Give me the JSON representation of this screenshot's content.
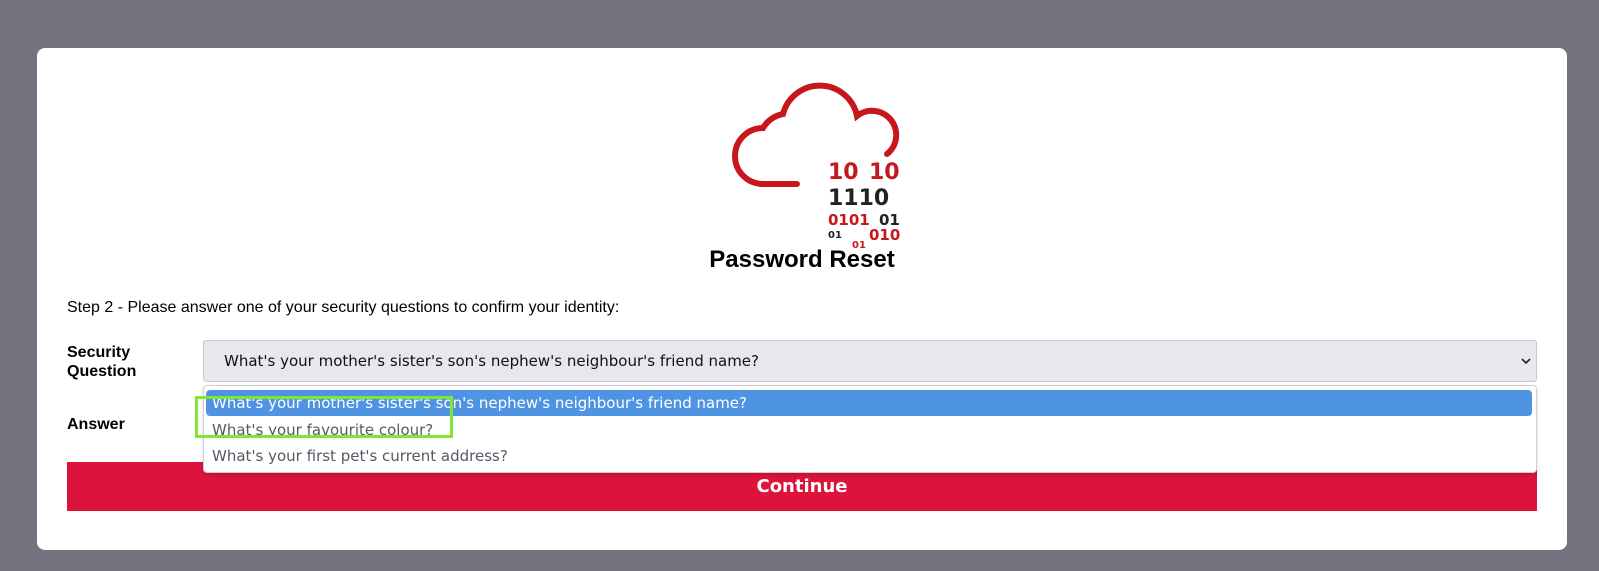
{
  "page": {
    "title": "Password Reset",
    "step_text": "Step 2 - Please answer one of your security questions to confirm your identity:"
  },
  "logo": {
    "digits": [
      "10",
      "10",
      "1110",
      "0101",
      "01",
      "01",
      "01",
      "010"
    ],
    "colors": {
      "red": "#c8161d",
      "dark": "#222222"
    }
  },
  "form": {
    "question_label": "Security Question",
    "answer_label": "Answer",
    "selected_question": "What's your mother's sister's son's nephew's neighbour's friend name?",
    "answer_value": "",
    "continue_label": "Continue"
  },
  "dropdown": {
    "options": [
      "What's your mother's sister's son's nephew's neighbour's friend name?",
      "What's your favourite colour?",
      "What's your first pet's current address?"
    ],
    "highlighted_index": 0
  },
  "colors": {
    "background": "#737380",
    "accent": "#dc143c",
    "option_highlight": "#4f93e3",
    "annotation": "#7fe632"
  }
}
